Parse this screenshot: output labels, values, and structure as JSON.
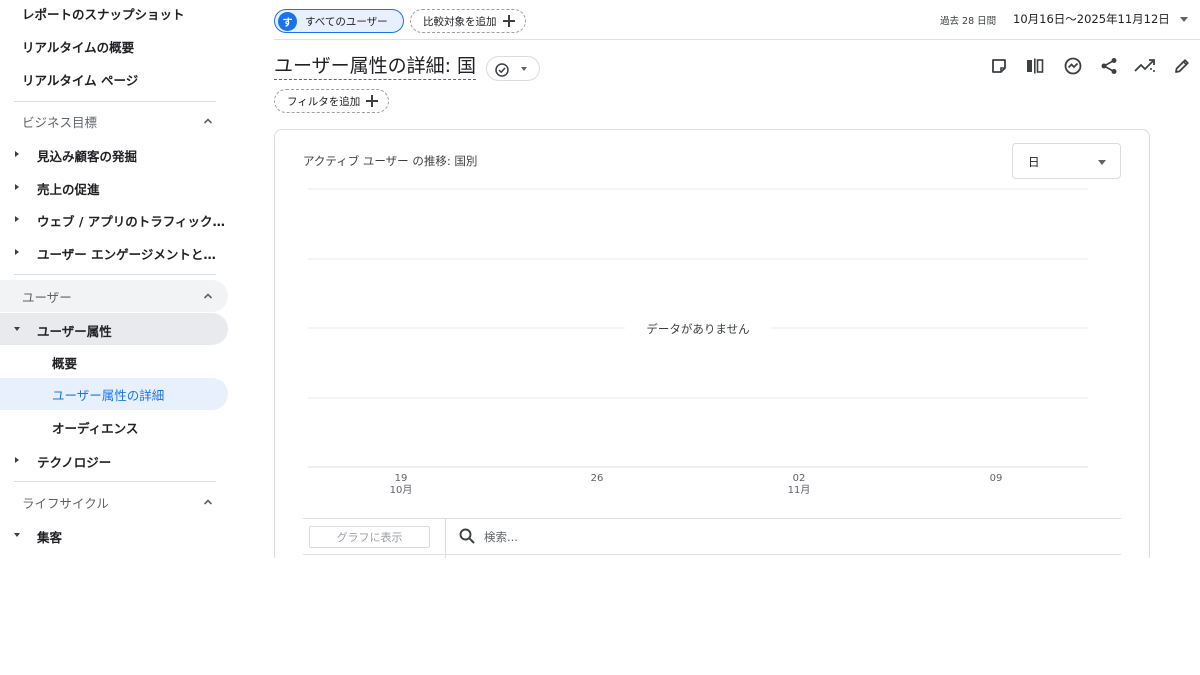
{
  "sidebar": {
    "top_items": [
      "レポートのスナップショット",
      "リアルタイムの概要",
      "リアルタイム ページ"
    ],
    "sections": {
      "business": {
        "title": "ビジネス目標",
        "items": [
          "見込み顧客の発掘",
          "売上の促進",
          "ウェブ / アプリのトラフィック…",
          "ユーザー エンゲージメントと…"
        ]
      },
      "user": {
        "title": "ユーザー",
        "group": "ユーザー属性",
        "subitems": [
          "概要",
          "ユーザー属性の詳細",
          "オーディエンス"
        ],
        "tech": "テクノロジー"
      },
      "lifecycle": {
        "title": "ライフサイクル",
        "items": [
          "集客"
        ]
      }
    }
  },
  "topbar": {
    "segment_avatar": "す",
    "segment_label": "すべてのユーザー",
    "compare_label": "比較対象を追加",
    "date_label": "過去 28 日間",
    "date_range": "10月16日～2025年11月12日"
  },
  "title": {
    "text": "ユーザー属性の詳細: 国",
    "filter_label": "フィルタを追加"
  },
  "toolbar": {
    "icons": [
      "note-icon",
      "compare-columns-icon",
      "insights-icon",
      "share-icon",
      "trend-icon",
      "edit-icon"
    ]
  },
  "chart": {
    "title": "アクティブ ユーザー の推移: 国別",
    "granularity": "日",
    "no_data": "データがありません",
    "ticks": [
      {
        "day": "19",
        "month": "10月"
      },
      {
        "day": "26",
        "month": ""
      },
      {
        "day": "02",
        "month": "11月"
      },
      {
        "day": "09",
        "month": ""
      }
    ]
  },
  "table": {
    "graph_button": "グラフに表示",
    "search_placeholder": "検索..."
  },
  "colors": {
    "accent": "#1a73e8",
    "selected_bg": "#e8f0fe",
    "border": "#dadce0"
  }
}
